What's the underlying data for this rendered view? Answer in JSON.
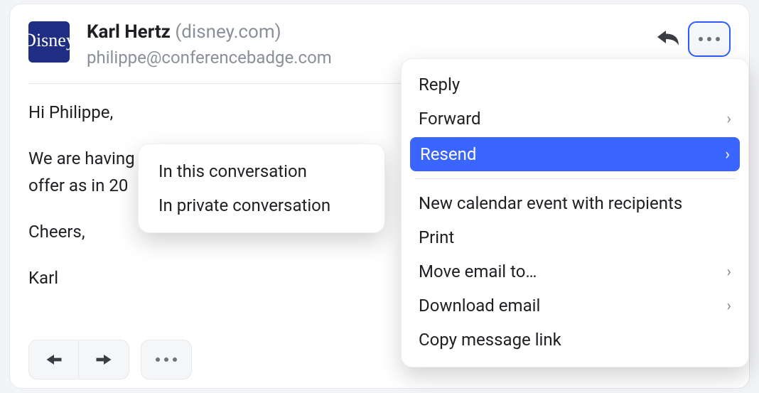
{
  "avatar": {
    "label": "Disney"
  },
  "sender": {
    "name": "Karl Hertz",
    "domain_paren": "(disney.com)",
    "to": "philippe@conferencebadge.com"
  },
  "body": {
    "greeting": "Hi Philippe,",
    "line1": "We are having",
    "line2": "offer as in 20",
    "signoff": "Cheers,",
    "signature_name": "Karl"
  },
  "menu": {
    "reply": "Reply",
    "forward": "Forward",
    "resend": "Resend",
    "new_event": "New calendar event with recipients",
    "print": "Print",
    "move_to": "Move email to…",
    "download": "Download email",
    "copy_link": "Copy message link"
  },
  "submenu": {
    "in_conversation": "In this conversation",
    "in_private": "In private conversation"
  }
}
